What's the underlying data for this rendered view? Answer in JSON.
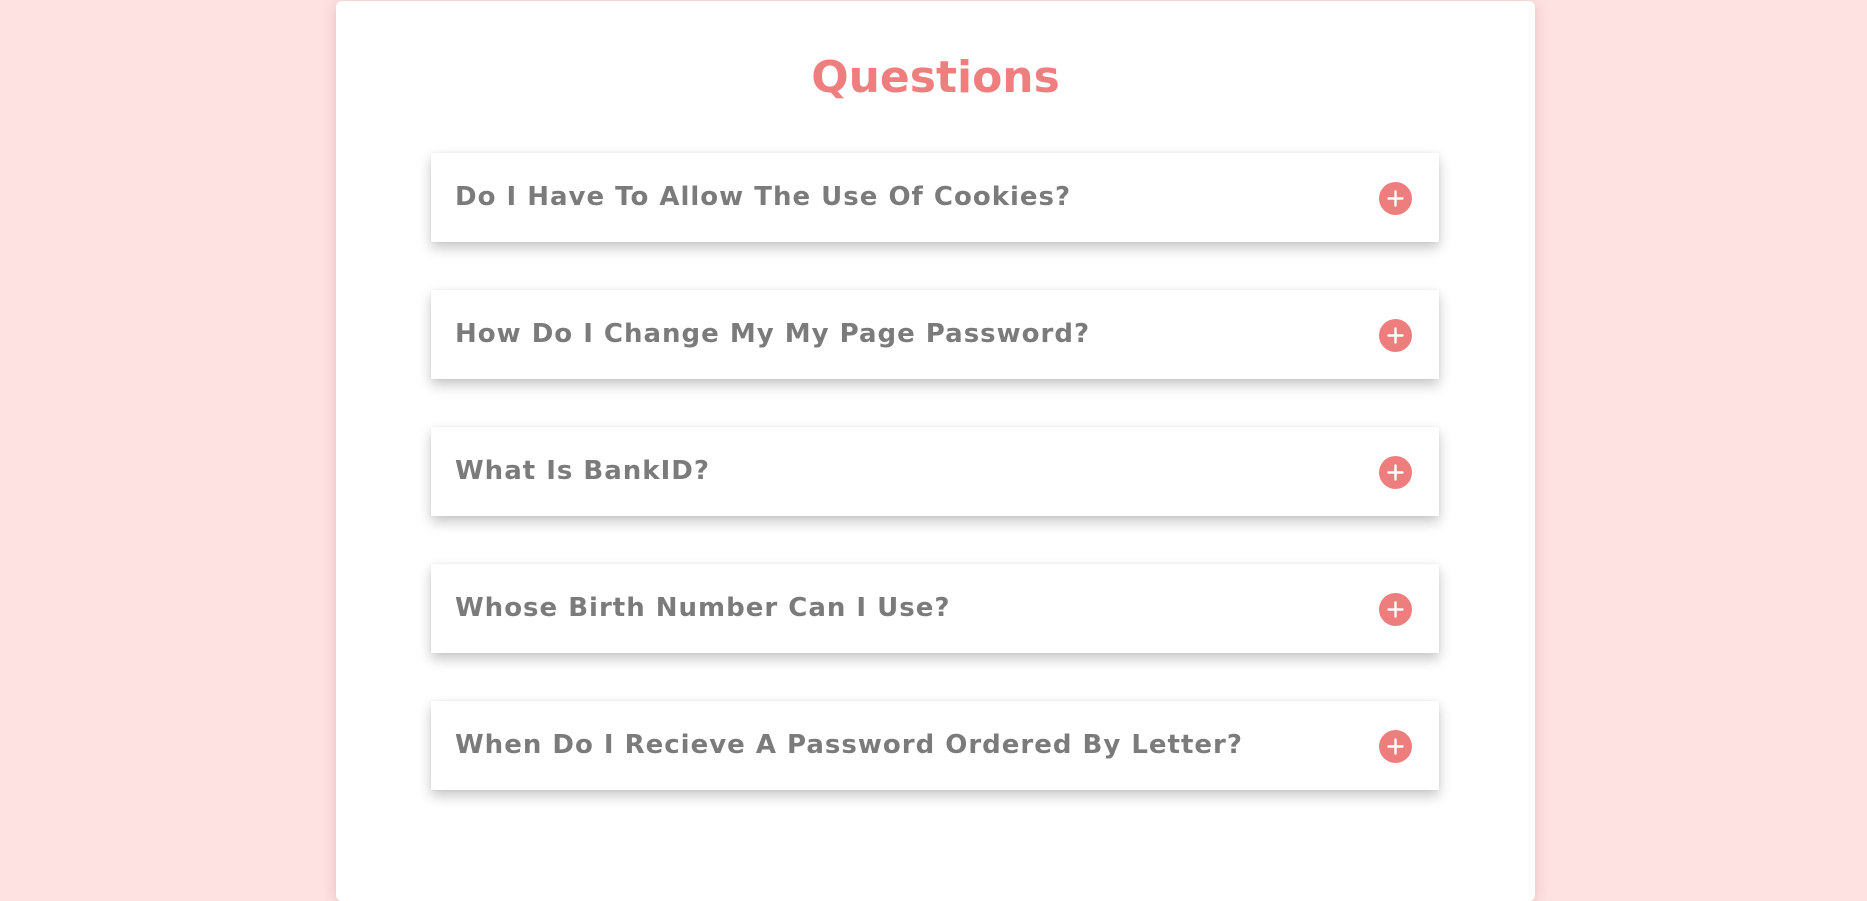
{
  "page": {
    "title": "Questions"
  },
  "faq": {
    "items": [
      {
        "question": "Do I Have To Allow The Use Of Cookies?",
        "icon": "plus-circle-icon"
      },
      {
        "question": "How Do I Change My My Page Password?",
        "icon": "plus-circle-icon"
      },
      {
        "question": "What Is BankID?",
        "icon": "plus-circle-icon"
      },
      {
        "question": "Whose Birth Number Can I Use?",
        "icon": "plus-circle-icon"
      },
      {
        "question": "When Do I Recieve A Password Ordered By Letter?",
        "icon": "plus-circle-icon"
      }
    ]
  },
  "colors": {
    "page_background": "#fee2e1",
    "accent": "#ef7f7f",
    "question_text": "#7b7b7b",
    "card_background": "#ffffff"
  }
}
